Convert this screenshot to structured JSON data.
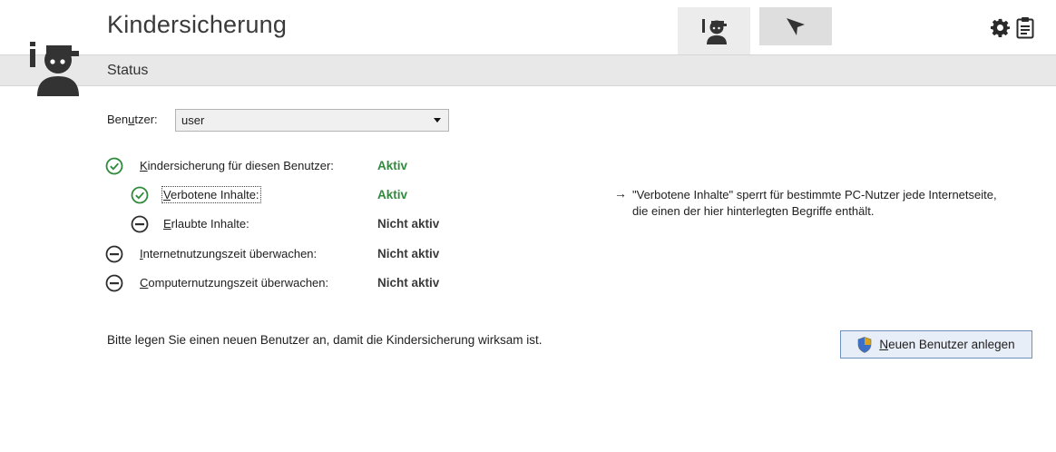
{
  "header": {
    "title": "Kindersicherung",
    "status": "Status"
  },
  "tabs": [
    {
      "icon": "parental-control-icon",
      "active": true
    },
    {
      "icon": "filter-funnel-icon",
      "active": false
    }
  ],
  "toolbar": {
    "settings_icon": "gear-icon",
    "clipboard_icon": "clipboard-icon"
  },
  "user": {
    "label_pre": "Ben",
    "label_ul": "u",
    "label_post": "tzer:",
    "value": "user"
  },
  "rows": [
    {
      "ul": "K",
      "rest": "indersicherung für diesen Benutzer:",
      "value": "Aktiv",
      "state": "on"
    },
    {
      "ul": "V",
      "rest": "erbotene Inhalte:",
      "value": "Aktiv",
      "state": "on"
    },
    {
      "ul": "E",
      "rest": "rlaubte Inhalte:",
      "value": "Nicht aktiv",
      "state": "off"
    },
    {
      "ul": "I",
      "rest": "nternetnutzungszeit überwachen:",
      "value": "Nicht aktiv",
      "state": "off"
    },
    {
      "ul": "C",
      "rest": "omputernutzungszeit überwachen:",
      "value": "Nicht aktiv",
      "state": "off"
    }
  ],
  "hint": {
    "arrow": "→",
    "text": "\"Verbotene Inhalte\" sperrt für bestimmte PC-Nutzer jede Internetseite, die einen der hier hinterlegten Begriffe enthält."
  },
  "info": "Bitte legen Sie einen neuen Benutzer an, damit die Kindersicherung wirksam ist.",
  "new_user_button": {
    "ul": "N",
    "rest": "euen Benutzer anlegen"
  },
  "colors": {
    "active": "#2f8a3c",
    "inactive": "#3a3a3a",
    "statusbar": "#e8e8e8"
  }
}
